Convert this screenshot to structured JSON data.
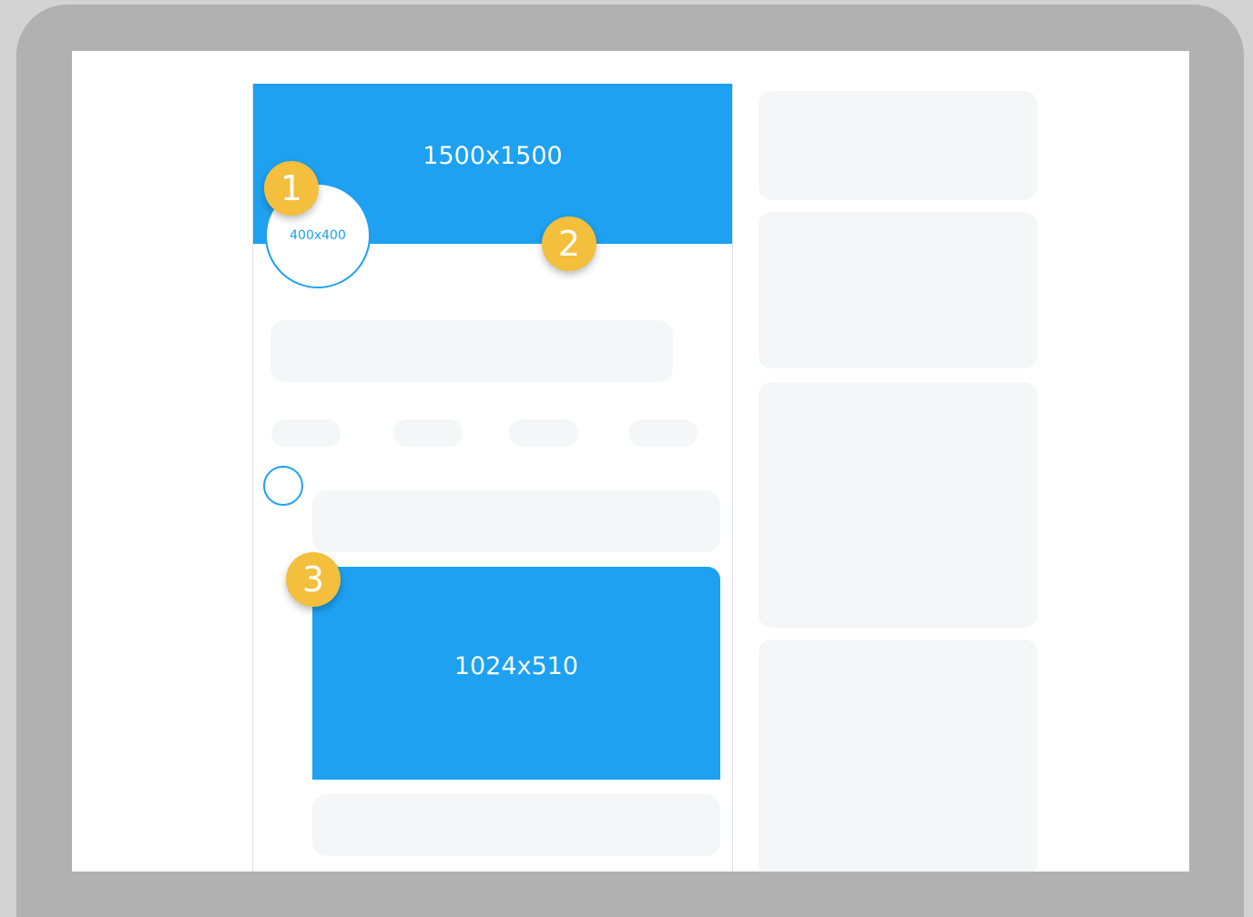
{
  "banner": {
    "label": "1500x1500"
  },
  "avatar": {
    "label": "400x400"
  },
  "tweet_image": {
    "label": "1024x510"
  },
  "badges": [
    "1",
    "2",
    "3"
  ],
  "colors": {
    "accent": "#1da1f0",
    "badge": "#f3bf3c",
    "frame": "#b1b1b1",
    "placeholder": "#f5f6f8"
  }
}
